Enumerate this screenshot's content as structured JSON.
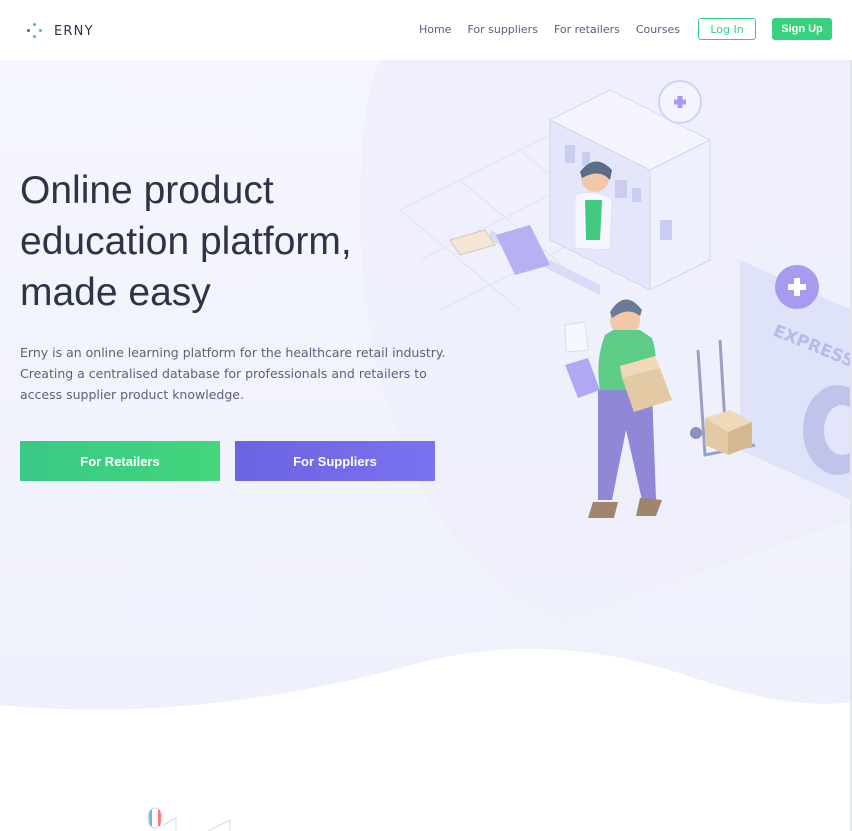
{
  "brand": {
    "name": "ERNY",
    "dot_color": "#39d07e",
    "dot_color_alt": "#4a5fc9"
  },
  "nav": {
    "links": [
      "Home",
      "For suppliers",
      "For retailers",
      "Courses"
    ],
    "login_label": "Log In",
    "signup_label": "Sign Up"
  },
  "hero": {
    "title_lines": [
      "Online product",
      "education platform,",
      "made easy"
    ],
    "description_lines": [
      "Erny is an online learning platform for the healthcare retail industry.",
      "Creating a centralised database for professionals and retailers to",
      "access supplier product knowledge."
    ],
    "cta_retailers": "For Retailers",
    "cta_suppliers": "For Suppliers",
    "illustration_sign": "EXPRESS"
  },
  "colors": {
    "green": "#39d07e",
    "purple": "#6f67e6",
    "text": "#2c3446"
  }
}
